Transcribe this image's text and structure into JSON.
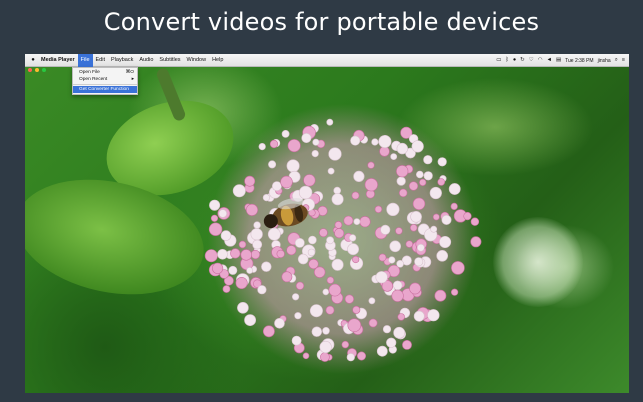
{
  "headline": "Convert videos for portable devices",
  "menubar": {
    "apple_icon": "apple-icon",
    "items": [
      {
        "label": "Media Player",
        "name": "menu-app"
      },
      {
        "label": "File",
        "name": "menu-file"
      },
      {
        "label": "Edit",
        "name": "menu-edit"
      },
      {
        "label": "Playback",
        "name": "menu-playback"
      },
      {
        "label": "Audio",
        "name": "menu-audio"
      },
      {
        "label": "Subtitles",
        "name": "menu-subtitles"
      },
      {
        "label": "Window",
        "name": "menu-window"
      },
      {
        "label": "Help",
        "name": "menu-help"
      }
    ],
    "status": {
      "clock": "Tue 2:38 PM",
      "user": "jinsha"
    }
  },
  "file_menu": {
    "items": [
      {
        "label": "Open File",
        "shortcut": "⌘O"
      },
      {
        "label": "Open Recent",
        "shortcut": "▸"
      },
      {
        "label": "Get Converter Function",
        "shortcut": ""
      }
    ]
  },
  "colors": {
    "background": "#2f3a45",
    "menu_highlight": "#3a72d8",
    "petal_pink": "#e9a6cc",
    "petal_white": "#f3e7ee"
  }
}
